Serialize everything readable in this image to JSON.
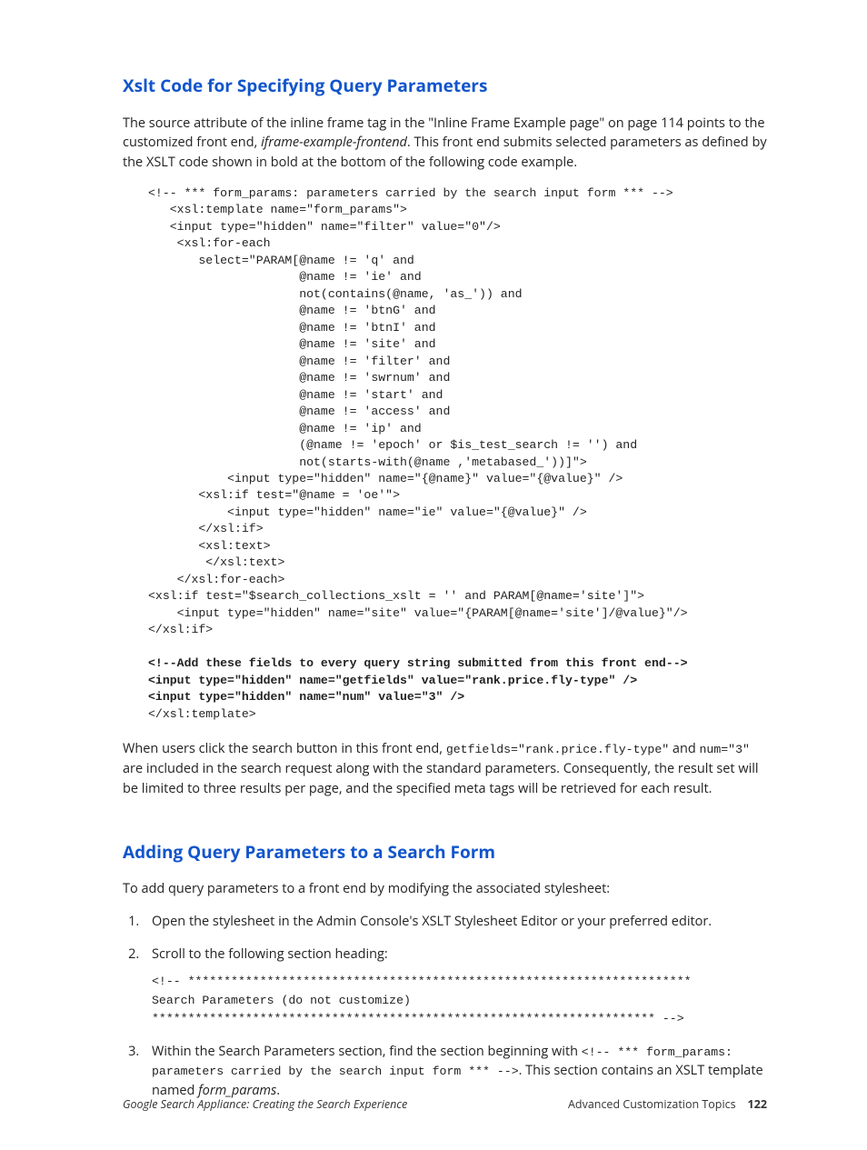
{
  "section1": {
    "heading": "Xslt Code for Specifying Query Parameters",
    "intro_pre": "The source attribute of the inline frame tag in the \"Inline Frame Example page\" on page 114 points to the customized front end, ",
    "intro_em": "iframe-example-frontend",
    "intro_post": ". This front end submits selected parameters as defined by the XSLT code shown in bold at the bottom of the following code example.",
    "code_plain": "<!-- *** form_params: parameters carried by the search input form *** -->\n   <xsl:template name=\"form_params\">\n   <input type=\"hidden\" name=\"filter\" value=\"0\"/>\n    <xsl:for-each\n       select=\"PARAM[@name != 'q' and\n                     @name != 'ie' and\n                     not(contains(@name, 'as_')) and\n                     @name != 'btnG' and\n                     @name != 'btnI' and\n                     @name != 'site' and\n                     @name != 'filter' and\n                     @name != 'swrnum' and\n                     @name != 'start' and\n                     @name != 'access' and\n                     @name != 'ip' and\n                     (@name != 'epoch' or $is_test_search != '') and\n                     not(starts-with(@name ,'metabased_'))]\">\n           <input type=\"hidden\" name=\"{@name}\" value=\"{@value}\" />\n       <xsl:if test=\"@name = 'oe'\">\n           <input type=\"hidden\" name=\"ie\" value=\"{@value}\" />\n       </xsl:if>\n       <xsl:text>\n        </xsl:text>\n    </xsl:for-each>\n<xsl:if test=\"$search_collections_xslt = '' and PARAM[@name='site']\">\n    <input type=\"hidden\" name=\"site\" value=\"{PARAM[@name='site']/@value}\"/>\n</xsl:if>\n",
    "code_bold": "<!--Add these fields to every query string submitted from this front end-->\n<input type=\"hidden\" name=\"getfields\" value=\"rank.price.fly-type\" />\n<input type=\"hidden\" name=\"num\" value=\"3\" />",
    "code_after_bold": "\n</xsl:template>",
    "outro_pre": "When users click the search button in this front end, ",
    "outro_code1": "getfields=\"rank.price.fly-type\"",
    "outro_mid1": " and ",
    "outro_code2": "num=\"3\"",
    "outro_post": " are included in the search request along with the standard parameters. Consequently, the result set will be limited to three results per page, and the specified meta tags will be retrieved for each result."
  },
  "section2": {
    "heading": "Adding Query Parameters to a Search Form",
    "intro": "To add query parameters to a front end by modifying the associated stylesheet:",
    "step1": "Open the stylesheet in the Admin Console's XSLT Stylesheet Editor or your preferred editor.",
    "step2_text": "Scroll to the following section heading:",
    "step2_code": "<!-- **********************************************************************\nSearch Parameters (do not customize)\n********************************************************************** -->",
    "step3_pre": "Within the Search Parameters section, find the section beginning with ",
    "step3_code": "<!-- *** form_params: parameters carried by the search input form *** -->",
    "step3_mid": ". This section contains an XSLT template named ",
    "step3_em": "form_params",
    "step3_post": "."
  },
  "footer": {
    "left": "Google Search Appliance: Creating the Search Experience",
    "right_text": "Advanced Customization Topics",
    "page_num": "122"
  }
}
